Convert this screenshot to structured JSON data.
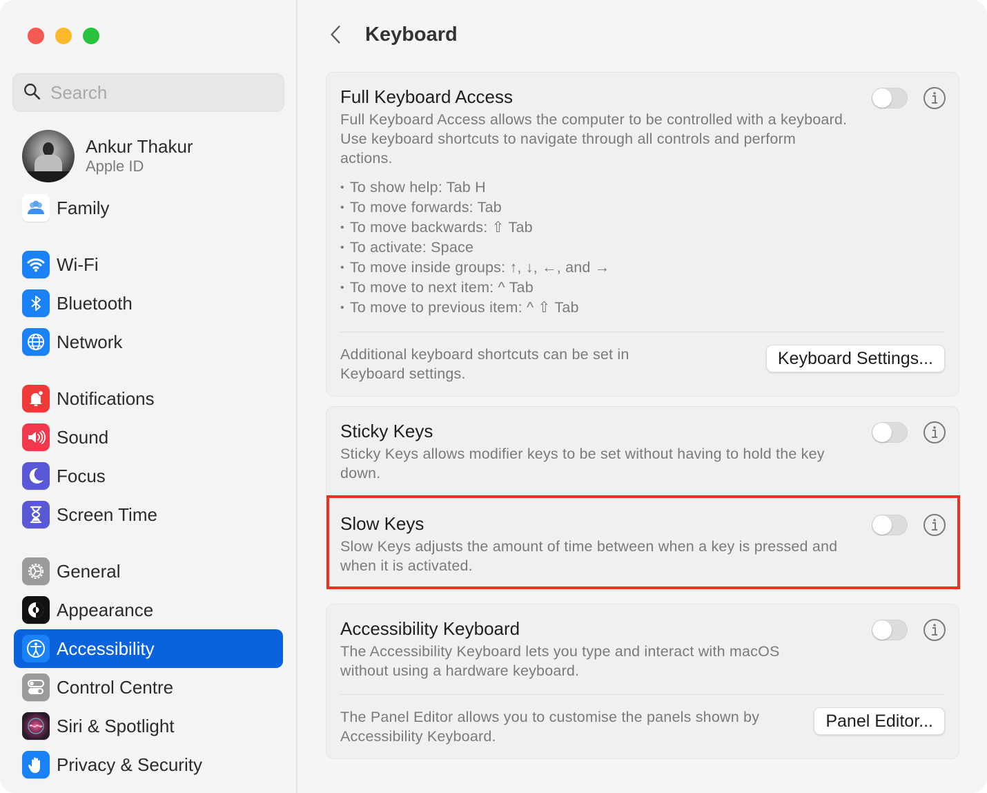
{
  "window": {
    "traffic_lights": [
      "close",
      "minimize",
      "maximize"
    ]
  },
  "sidebar": {
    "search": {
      "placeholder": "Search",
      "value": ""
    },
    "profile": {
      "name": "Ankur Thakur",
      "subtitle": "Apple ID"
    },
    "family": {
      "label": "Family",
      "icon": "family-icon"
    },
    "groups": [
      [
        {
          "label": "Wi-Fi",
          "icon": "wifi-icon",
          "color": "#1a82f7"
        },
        {
          "label": "Bluetooth",
          "icon": "bluetooth-icon",
          "color": "#1a82f7"
        },
        {
          "label": "Network",
          "icon": "globe-icon",
          "color": "#1a82f7"
        }
      ],
      [
        {
          "label": "Notifications",
          "icon": "bell-icon",
          "color": "#f03a3a"
        },
        {
          "label": "Sound",
          "icon": "speaker-icon",
          "color": "#f0394c"
        },
        {
          "label": "Focus",
          "icon": "moon-icon",
          "color": "#5a58d6"
        },
        {
          "label": "Screen Time",
          "icon": "hourglass-icon",
          "color": "#5a58d6"
        }
      ],
      [
        {
          "label": "General",
          "icon": "gear-icon",
          "color": "#9a9a9a"
        },
        {
          "label": "Appearance",
          "icon": "appearance-icon",
          "color": "#111111"
        },
        {
          "label": "Accessibility",
          "icon": "accessibility-icon",
          "color": "#1a82f7",
          "active": true
        },
        {
          "label": "Control Centre",
          "icon": "control-centre-icon",
          "color": "#9a9a9a"
        },
        {
          "label": "Siri & Spotlight",
          "icon": "siri-icon",
          "color": "#7a2a55"
        },
        {
          "label": "Privacy & Security",
          "icon": "hand-icon",
          "color": "#1a82f7"
        }
      ]
    ],
    "active_color": "#0a63dc"
  },
  "main": {
    "title": "Keyboard",
    "cards": {
      "full_keyboard_access": {
        "title": "Full Keyboard Access",
        "description": "Full Keyboard Access allows the computer to be controlled with a keyboard. Use keyboard shortcuts to navigate through all controls and perform actions.",
        "enabled": false,
        "shortcuts": [
          "To show help: Tab H",
          "To move forwards: Tab",
          "To move backwards: ⇧ Tab",
          "To activate: Space",
          "To move inside groups: ↑, ↓, ←, and →",
          "To move to next item: ^ Tab",
          "To move to previous item: ^ ⇧ Tab"
        ],
        "footer_text": "Additional keyboard shortcuts can be set in Keyboard settings.",
        "footer_button": "Keyboard Settings..."
      },
      "sticky_keys": {
        "title": "Sticky Keys",
        "description": "Sticky Keys allows modifier keys to be set without having to hold the key down.",
        "enabled": false
      },
      "slow_keys": {
        "title": "Slow Keys",
        "description": "Slow Keys adjusts the amount of time between when a key is pressed and when it is activated.",
        "enabled": false,
        "highlighted": true,
        "highlight_color": "#f0301e"
      },
      "accessibility_keyboard": {
        "title": "Accessibility Keyboard",
        "description": "The Accessibility Keyboard lets you type and interact with macOS without using a hardware keyboard.",
        "enabled": false,
        "footer_text": "The Panel Editor allows you to customise the panels shown by Accessibility Keyboard.",
        "footer_button": "Panel Editor..."
      }
    }
  }
}
